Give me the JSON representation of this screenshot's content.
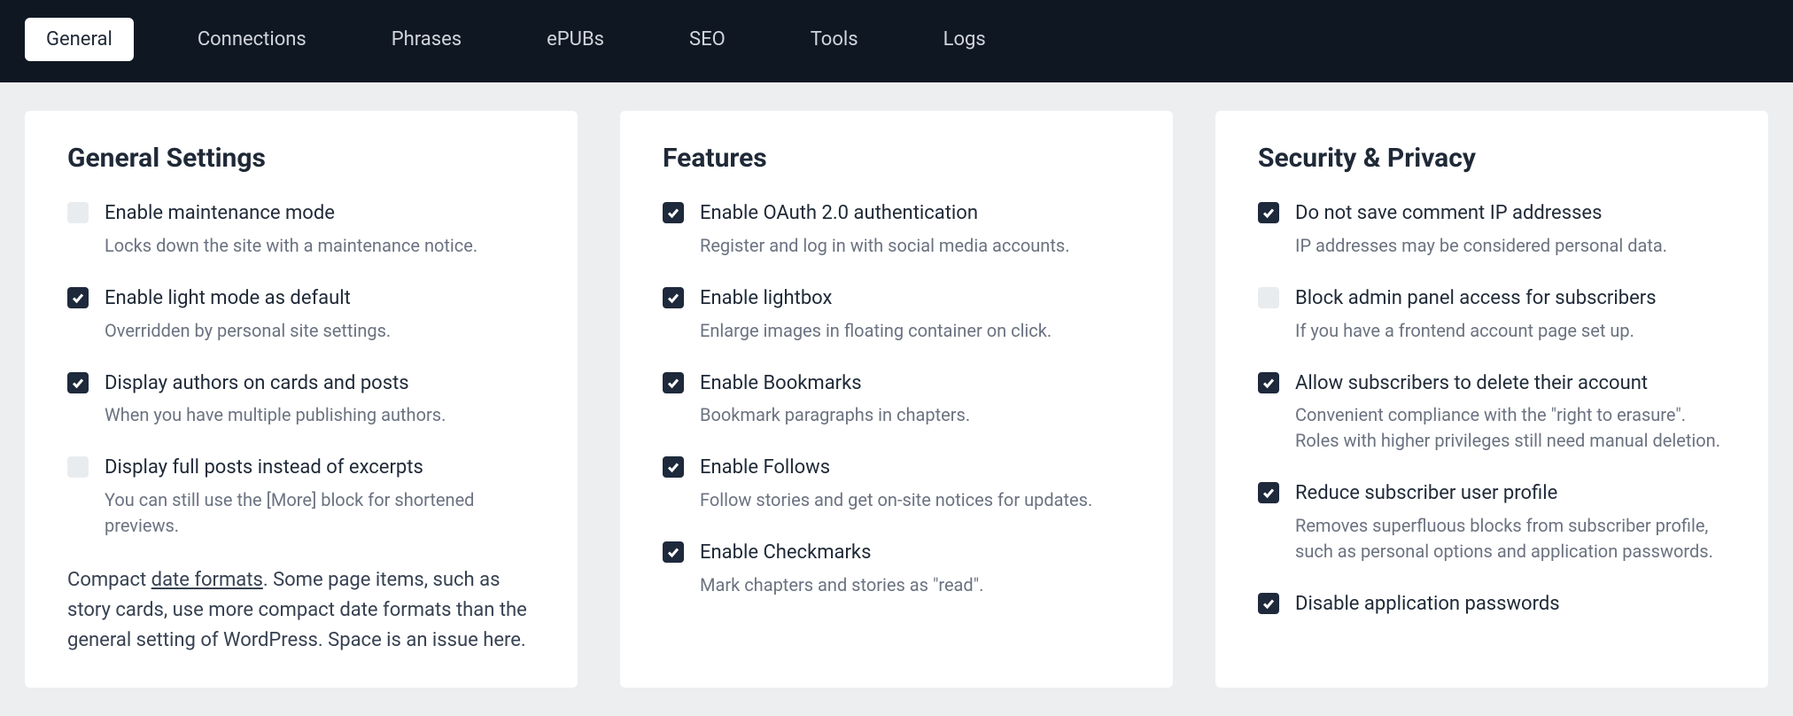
{
  "tabs": [
    {
      "label": "General",
      "active": true
    },
    {
      "label": "Connections",
      "active": false
    },
    {
      "label": "Phrases",
      "active": false
    },
    {
      "label": "ePUBs",
      "active": false
    },
    {
      "label": "SEO",
      "active": false
    },
    {
      "label": "Tools",
      "active": false
    },
    {
      "label": "Logs",
      "active": false
    }
  ],
  "columns": {
    "general": {
      "title": "General Settings",
      "settings": [
        {
          "checked": false,
          "label": "Enable maintenance mode",
          "desc": "Locks down the site with a maintenance notice."
        },
        {
          "checked": true,
          "label": "Enable light mode as default",
          "desc": "Overridden by personal site settings."
        },
        {
          "checked": true,
          "label": "Display authors on cards and posts",
          "desc": "When you have multiple publishing authors."
        },
        {
          "checked": false,
          "label": "Display full posts instead of excerpts",
          "desc": "You can still use the [More] block for shortened previews."
        }
      ],
      "note_prefix": "Compact ",
      "note_link": "date formats",
      "note_suffix": ". Some page items, such as story cards, use more compact date formats than the general setting of WordPress. Space is an issue here."
    },
    "features": {
      "title": "Features",
      "settings": [
        {
          "checked": true,
          "label": "Enable OAuth 2.0 authentication",
          "desc": "Register and log in with social media accounts."
        },
        {
          "checked": true,
          "label": "Enable lightbox",
          "desc": "Enlarge images in floating container on click."
        },
        {
          "checked": true,
          "label": "Enable Bookmarks",
          "desc": "Bookmark paragraphs in chapters."
        },
        {
          "checked": true,
          "label": "Enable Follows",
          "desc": "Follow stories and get on-site notices for updates."
        },
        {
          "checked": true,
          "label": "Enable Checkmarks",
          "desc": "Mark chapters and stories as \"read\"."
        }
      ]
    },
    "security": {
      "title": "Security & Privacy",
      "settings": [
        {
          "checked": true,
          "label": "Do not save comment IP addresses",
          "desc": "IP addresses may be considered personal data."
        },
        {
          "checked": false,
          "label": "Block admin panel access for subscribers",
          "desc": "If you have a frontend account page set up."
        },
        {
          "checked": true,
          "label": "Allow subscribers to delete their account",
          "desc": "Convenient compliance with the \"right to erasure\". Roles with higher privileges still need manual deletion."
        },
        {
          "checked": true,
          "label": "Reduce subscriber user profile",
          "desc": "Removes superfluous blocks from subscriber profile, such as personal options and application passwords."
        },
        {
          "checked": true,
          "label": "Disable application passwords",
          "desc": ""
        }
      ]
    }
  }
}
